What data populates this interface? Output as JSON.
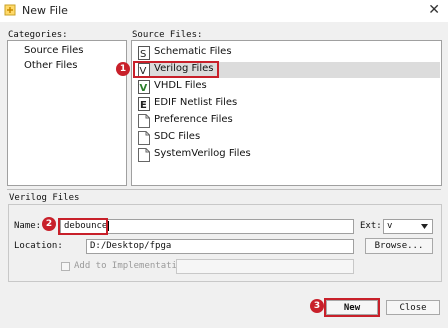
{
  "window": {
    "title": "New File",
    "close_glyph": "✕"
  },
  "categories": {
    "label": "Categories:",
    "items": [
      "Source Files",
      "Other Files"
    ]
  },
  "source_files": {
    "label": "Source Files:",
    "items": [
      {
        "label": "Schematic Files",
        "icon": "schematic-file-icon"
      },
      {
        "label": "Verilog Files",
        "icon": "verilog-file-icon"
      },
      {
        "label": "VHDL Files",
        "icon": "vhdl-file-icon"
      },
      {
        "label": "EDIF Netlist Files",
        "icon": "edif-file-icon"
      },
      {
        "label": "Preference Files",
        "icon": "preference-file-icon"
      },
      {
        "label": "SDC Files",
        "icon": "sdc-file-icon"
      },
      {
        "label": "SystemVerilog Files",
        "icon": "systemverilog-file-icon"
      }
    ],
    "selected": "Verilog Files"
  },
  "section": {
    "title": "Verilog Files"
  },
  "form": {
    "name_label": "Name:",
    "name_value": "debounce",
    "ext_label": "Ext:",
    "ext_value": "v",
    "location_label": "Location:",
    "location_value": "D:/Desktop/fpga",
    "browse_label": "Browse...",
    "add_label": "Add to Implementation"
  },
  "buttons": {
    "new": "New",
    "close": "Close"
  },
  "annotations": [
    "1",
    "2",
    "3"
  ],
  "colors": {
    "annotation": "#c8202a",
    "selection": "#dcdcdc"
  }
}
